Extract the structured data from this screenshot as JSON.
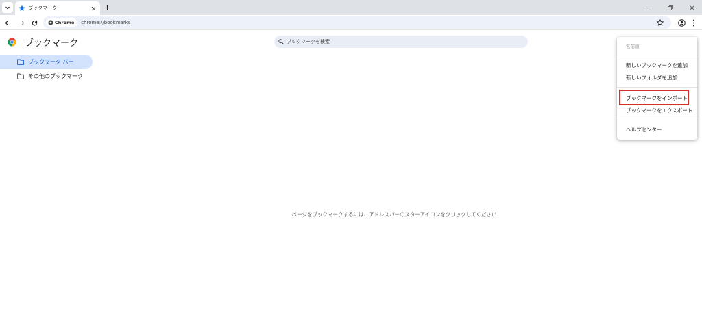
{
  "browser": {
    "tab": {
      "title": "ブックマーク"
    },
    "omnibox": {
      "chip_label": "Chrome",
      "url": "chrome://bookmarks"
    }
  },
  "page": {
    "title": "ブックマーク",
    "search": {
      "placeholder": "ブックマークを検索"
    },
    "sidebar": {
      "items": [
        {
          "label": "ブックマーク バー",
          "selected": true
        },
        {
          "label": "その他のブックマーク",
          "selected": false
        }
      ]
    },
    "empty_message": "ページをブックマークするには、アドレスバーのスターアイコンをクリックしてください"
  },
  "menu": {
    "sort_label": "名前順",
    "add_bookmark": "新しいブックマークを追加",
    "add_folder": "新しいフォルダを追加",
    "import": "ブックマークをインポート",
    "export": "ブックマークをエクスポート",
    "help": "ヘルプセンター",
    "highlighted_item": "import"
  },
  "colors": {
    "accent": "#0b57d0",
    "selected_bg": "#d3e3fd",
    "highlight_border": "#d32f2f",
    "tabstrip_bg": "#dee1e6",
    "omnibox_bg": "#edf2fa"
  }
}
